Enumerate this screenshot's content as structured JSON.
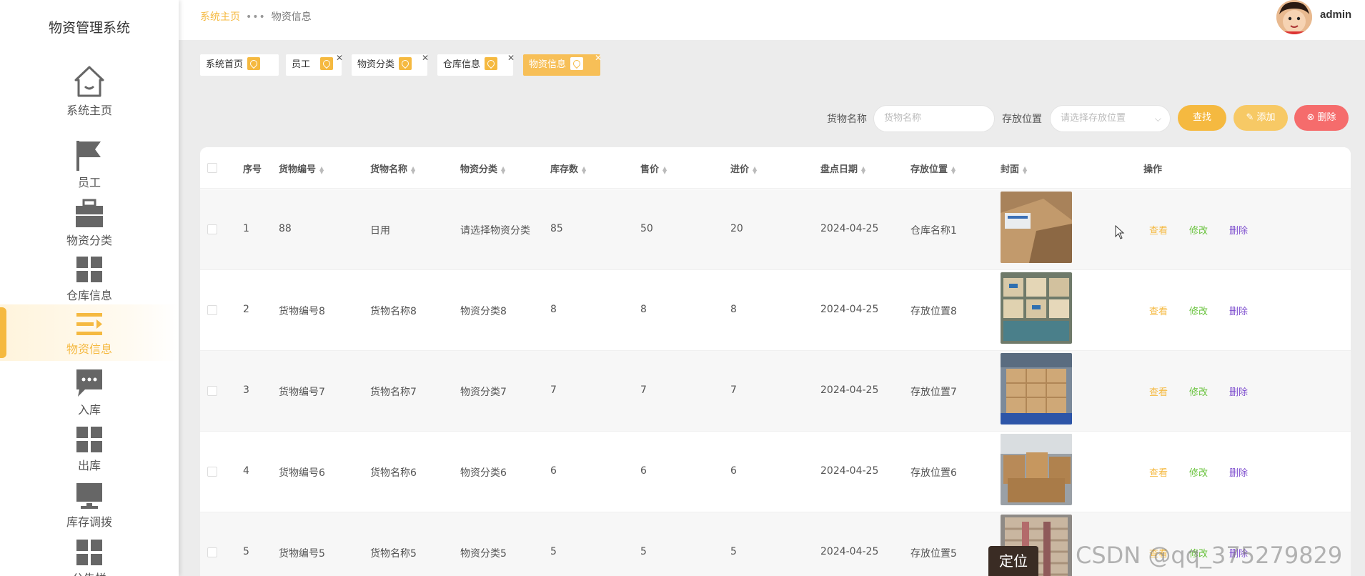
{
  "sidebar": {
    "title": "物资管理系统",
    "items": [
      {
        "label": "系统主页",
        "icon": "home-icon"
      },
      {
        "label": "员工",
        "icon": "flag-icon"
      },
      {
        "label": "物资分类",
        "icon": "briefcase-icon"
      },
      {
        "label": "仓库信息",
        "icon": "grid-icon"
      },
      {
        "label": "物资信息",
        "icon": "list-icon",
        "active": true
      },
      {
        "label": "入库",
        "icon": "chat-icon"
      },
      {
        "label": "出库",
        "icon": "grid-icon"
      },
      {
        "label": "库存调拨",
        "icon": "monitor-icon"
      },
      {
        "label": "公告栏",
        "icon": "grid-icon"
      }
    ]
  },
  "header": {
    "breadcrumb_home": "系统主页",
    "breadcrumb_sep": "•••",
    "breadcrumb_current": "物资信息",
    "username": "admin"
  },
  "tags": [
    {
      "label": "系统首页",
      "closable": false
    },
    {
      "label": "员工",
      "closable": true
    },
    {
      "label": "物资分类",
      "closable": true
    },
    {
      "label": "仓库信息",
      "closable": true
    },
    {
      "label": "物资信息",
      "closable": true,
      "active": true
    }
  ],
  "search": {
    "name_label": "货物名称",
    "name_placeholder": "货物名称",
    "location_label": "存放位置",
    "location_placeholder": "请选择存放位置",
    "find_btn": "查找",
    "add_btn": "添加",
    "delete_btn": "删除"
  },
  "table": {
    "headers": {
      "idx": "序号",
      "code": "货物编号",
      "name": "货物名称",
      "category": "物资分类",
      "stock": "库存数",
      "price": "售价",
      "cost": "进价",
      "date": "盘点日期",
      "location": "存放位置",
      "cover": "封面",
      "ops": "操作"
    },
    "rows": [
      {
        "idx": "1",
        "code": "88",
        "name": "日用",
        "category": "请选择物资分类",
        "stock": "85",
        "price": "50",
        "cost": "20",
        "date": "2024-04-25",
        "location": "仓库名称1"
      },
      {
        "idx": "2",
        "code": "货物编号8",
        "name": "货物名称8",
        "category": "物资分类8",
        "stock": "8",
        "price": "8",
        "cost": "8",
        "date": "2024-04-25",
        "location": "存放位置8"
      },
      {
        "idx": "3",
        "code": "货物编号7",
        "name": "货物名称7",
        "category": "物资分类7",
        "stock": "7",
        "price": "7",
        "cost": "7",
        "date": "2024-04-25",
        "location": "存放位置7"
      },
      {
        "idx": "4",
        "code": "货物编号6",
        "name": "货物名称6",
        "category": "物资分类6",
        "stock": "6",
        "price": "6",
        "cost": "6",
        "date": "2024-04-25",
        "location": "存放位置6"
      },
      {
        "idx": "5",
        "code": "货物编号5",
        "name": "货物名称5",
        "category": "物资分类5",
        "stock": "5",
        "price": "5",
        "cost": "5",
        "date": "2024-04-25",
        "location": "存放位置5"
      }
    ],
    "actions": {
      "view": "查看",
      "edit": "修改",
      "delete": "删除"
    }
  },
  "overlay": {
    "locate_button": "定位",
    "watermark": "CSDN @qq_375279829"
  },
  "colors": {
    "accent": "#f5b940",
    "delete_btn": "#f56c6c",
    "edit_link": "#67c23a",
    "delete_link": "#7f4fcf"
  }
}
